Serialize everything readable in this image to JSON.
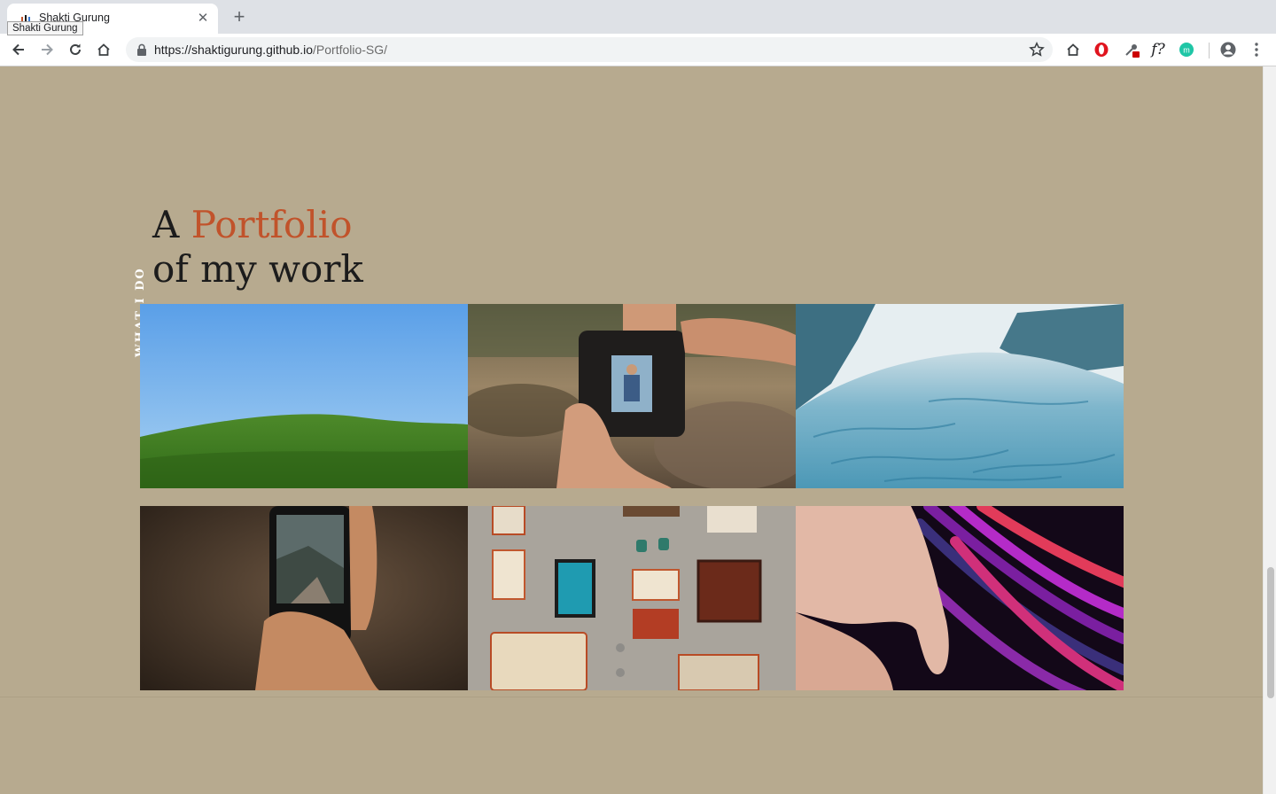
{
  "browser": {
    "tab_title": "Shakti Gurung",
    "tooltip": "Shakti Gurung",
    "url_host": "https://shaktigurung.github.io",
    "url_path": "/Portfolio-SG/"
  },
  "page": {
    "side_label": "WHAT I DO",
    "heading_prefix": "A",
    "heading_accent": "Portfolio",
    "heading_line2": "of my work",
    "accent_color": "#c1532b",
    "background_color": "#b7aa8f"
  },
  "gallery": [
    {
      "name": "green-hill-photo"
    },
    {
      "name": "camera-hands-photo"
    },
    {
      "name": "glacier-photo"
    },
    {
      "name": "phone-photo"
    },
    {
      "name": "coffee-wall-photo"
    },
    {
      "name": "hand-light-trails-photo"
    }
  ]
}
